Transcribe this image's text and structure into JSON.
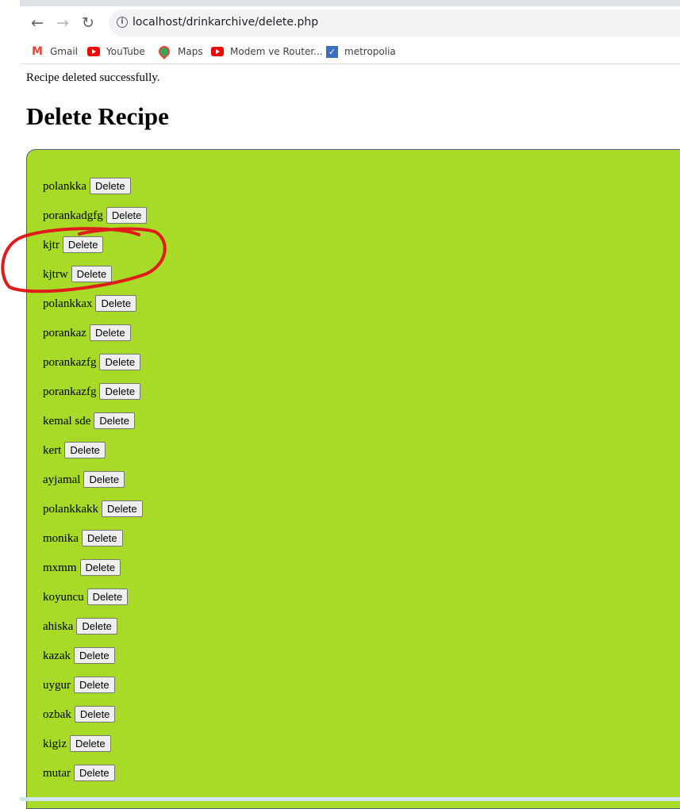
{
  "browser": {
    "url": "localhost/drinkarchive/delete.php",
    "bookmarks": [
      {
        "label": "Gmail",
        "icon": "gmail-icon"
      },
      {
        "label": "YouTube",
        "icon": "youtube-icon"
      },
      {
        "label": "Maps",
        "icon": "maps-icon"
      },
      {
        "label": "Modem ve Router...",
        "icon": "youtube-icon"
      },
      {
        "label": "metropolia",
        "icon": "metropolia-icon"
      }
    ]
  },
  "page": {
    "message": "Recipe deleted successfully.",
    "title": "Delete Recipe",
    "delete_label": "Delete",
    "panel_color": "#a8db27",
    "recipes": [
      "polankka",
      "porankadgfg",
      "kjtr",
      "kjtrw",
      "polankkax",
      "porankaz",
      "porankazfg",
      "porankazfg",
      "kemal sde",
      "kert",
      "ayjamal",
      "polankkakk",
      "monika",
      "mxmm",
      "koyuncu",
      "ahiska",
      "kazak",
      "uygur",
      "ozbak",
      "kigiz",
      "mutar"
    ]
  }
}
